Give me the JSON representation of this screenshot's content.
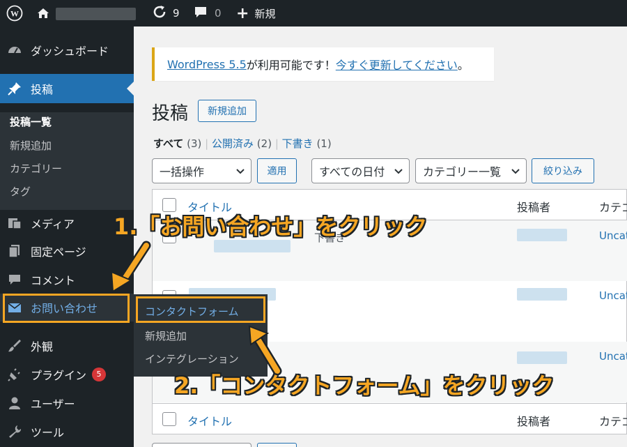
{
  "adminbar": {
    "update_count": "9",
    "comment_count": "0",
    "new_label": "新規"
  },
  "sidebar": {
    "items": [
      {
        "label": "ダッシュボード",
        "icon": "dashboard-icon"
      },
      {
        "label": "投稿",
        "icon": "pin-icon"
      },
      {
        "label": "メディア",
        "icon": "media-icon"
      },
      {
        "label": "固定ページ",
        "icon": "page-icon"
      },
      {
        "label": "コメント",
        "icon": "comment-icon"
      },
      {
        "label": "お問い合わせ",
        "icon": "mail-icon"
      },
      {
        "label": "外観",
        "icon": "brush-icon"
      },
      {
        "label": "プラグイン",
        "icon": "plugin-icon",
        "badge": "5"
      },
      {
        "label": "ユーザー",
        "icon": "user-icon"
      },
      {
        "label": "ツール",
        "icon": "wrench-icon"
      }
    ],
    "posts_submenu": [
      "投稿一覧",
      "新規追加",
      "カテゴリー",
      "タグ"
    ]
  },
  "flyout": {
    "items": [
      "コンタクトフォーム",
      "新規追加",
      "インテグレーション"
    ]
  },
  "notice": {
    "prefix": "WordPress 5.5",
    "middle": " が利用可能です！",
    "link": "今すぐ更新してください",
    "suffix": "。"
  },
  "page": {
    "title": "投稿",
    "add_new": "新規追加"
  },
  "views": {
    "all_label": "すべて",
    "all_count": "(3)",
    "published_label": "公開済み",
    "published_count": "(2)",
    "draft_label": "下書き",
    "draft_count": "(1)"
  },
  "filters": {
    "bulk_action": "一括操作",
    "apply": "適用",
    "dates": "すべての日付",
    "categories": "カテゴリー一覧",
    "filter": "絞り込み"
  },
  "table": {
    "col_title": "タイトル",
    "col_author": "投稿者",
    "col_category": "カテゴ",
    "rows": [
      {
        "status_text": "下書き",
        "category": "Uncat"
      },
      {
        "status_text": "",
        "category": "Uncat"
      },
      {
        "status_text": "",
        "category": "Uncat"
      }
    ]
  },
  "annotations": {
    "step1": "1.「お問い合わせ」をクリック",
    "step2": "2.「コンタクトフォーム」をクリック"
  },
  "colors": {
    "accent": "#2271b1",
    "highlight": "#f5a623",
    "adminbar": "#1d2327"
  }
}
